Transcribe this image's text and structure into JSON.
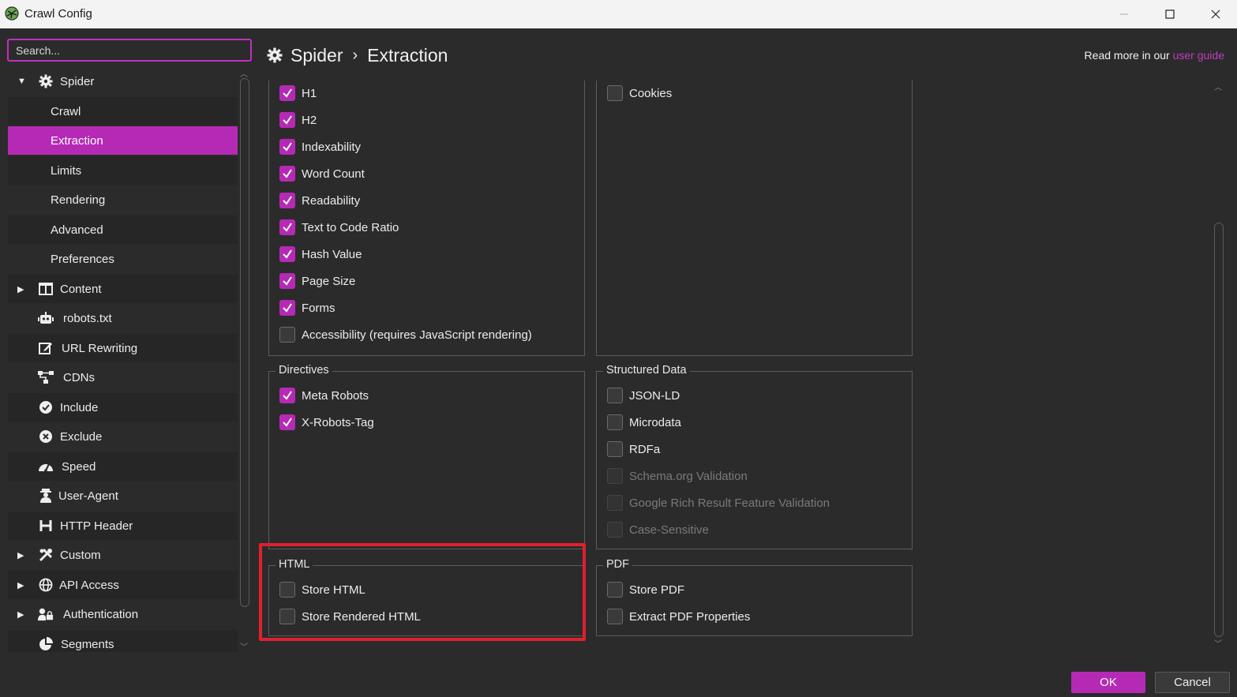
{
  "window": {
    "title": "Crawl Config"
  },
  "search": {
    "placeholder": "Search..."
  },
  "sidebar": {
    "items": [
      {
        "label": "Spider",
        "icon": "gear-icon",
        "expanded": true
      },
      {
        "label": "Crawl"
      },
      {
        "label": "Extraction",
        "active": true
      },
      {
        "label": "Limits"
      },
      {
        "label": "Rendering"
      },
      {
        "label": "Advanced"
      },
      {
        "label": "Preferences"
      },
      {
        "label": "Content",
        "icon": "columns-icon"
      },
      {
        "label": "robots.txt",
        "icon": "robot-icon"
      },
      {
        "label": "URL Rewriting",
        "icon": "edit-icon"
      },
      {
        "label": "CDNs",
        "icon": "network-icon"
      },
      {
        "label": "Include",
        "icon": "check-circle-icon"
      },
      {
        "label": "Exclude",
        "icon": "x-circle-icon"
      },
      {
        "label": "Speed",
        "icon": "speedometer-icon"
      },
      {
        "label": "User-Agent",
        "icon": "user-agent-icon"
      },
      {
        "label": "HTTP Header",
        "icon": "h-icon"
      },
      {
        "label": "Custom",
        "icon": "tools-icon"
      },
      {
        "label": "API Access",
        "icon": "globe-icon"
      },
      {
        "label": "Authentication",
        "icon": "user-lock-icon"
      },
      {
        "label": "Segments",
        "icon": "pie-chart-icon"
      }
    ]
  },
  "header": {
    "crumb_root": "Spider",
    "crumb_sep": "›",
    "crumb_page": "Extraction",
    "readmore_prefix": "Read more in our ",
    "readmore_link": "user guide"
  },
  "page_elements": {
    "items": [
      {
        "label": "H1",
        "checked": true
      },
      {
        "label": "H2",
        "checked": true
      },
      {
        "label": "Indexability",
        "checked": true
      },
      {
        "label": "Word Count",
        "checked": true
      },
      {
        "label": "Readability",
        "checked": true
      },
      {
        "label": "Text to Code Ratio",
        "checked": true
      },
      {
        "label": "Hash Value",
        "checked": true
      },
      {
        "label": "Page Size",
        "checked": true
      },
      {
        "label": "Forms",
        "checked": true
      },
      {
        "label": "Accessibility (requires JavaScript rendering)",
        "checked": false
      }
    ]
  },
  "url_details": {
    "items": [
      {
        "label": "Cookies",
        "checked": false
      }
    ]
  },
  "directives": {
    "legend": "Directives",
    "items": [
      {
        "label": "Meta Robots",
        "checked": true
      },
      {
        "label": "X-Robots-Tag",
        "checked": true
      }
    ]
  },
  "structured_data": {
    "legend": "Structured Data",
    "items": [
      {
        "label": "JSON-LD",
        "checked": false
      },
      {
        "label": "Microdata",
        "checked": false
      },
      {
        "label": "RDFa",
        "checked": false
      },
      {
        "label": "Schema.org Validation",
        "checked": false,
        "disabled": true
      },
      {
        "label": "Google Rich Result Feature Validation",
        "checked": false,
        "disabled": true
      },
      {
        "label": "Case-Sensitive",
        "checked": false,
        "disabled": true
      }
    ]
  },
  "html": {
    "legend": "HTML",
    "items": [
      {
        "label": "Store HTML",
        "checked": false
      },
      {
        "label": "Store Rendered HTML",
        "checked": false
      }
    ]
  },
  "pdf": {
    "legend": "PDF",
    "items": [
      {
        "label": "Store PDF",
        "checked": false
      },
      {
        "label": "Extract PDF Properties",
        "checked": false
      }
    ]
  },
  "footer": {
    "ok_label": "OK",
    "cancel_label": "Cancel"
  },
  "colors": {
    "accent": "#b52ab5",
    "highlight": "#e0202e",
    "background": "#2b2b2b"
  }
}
